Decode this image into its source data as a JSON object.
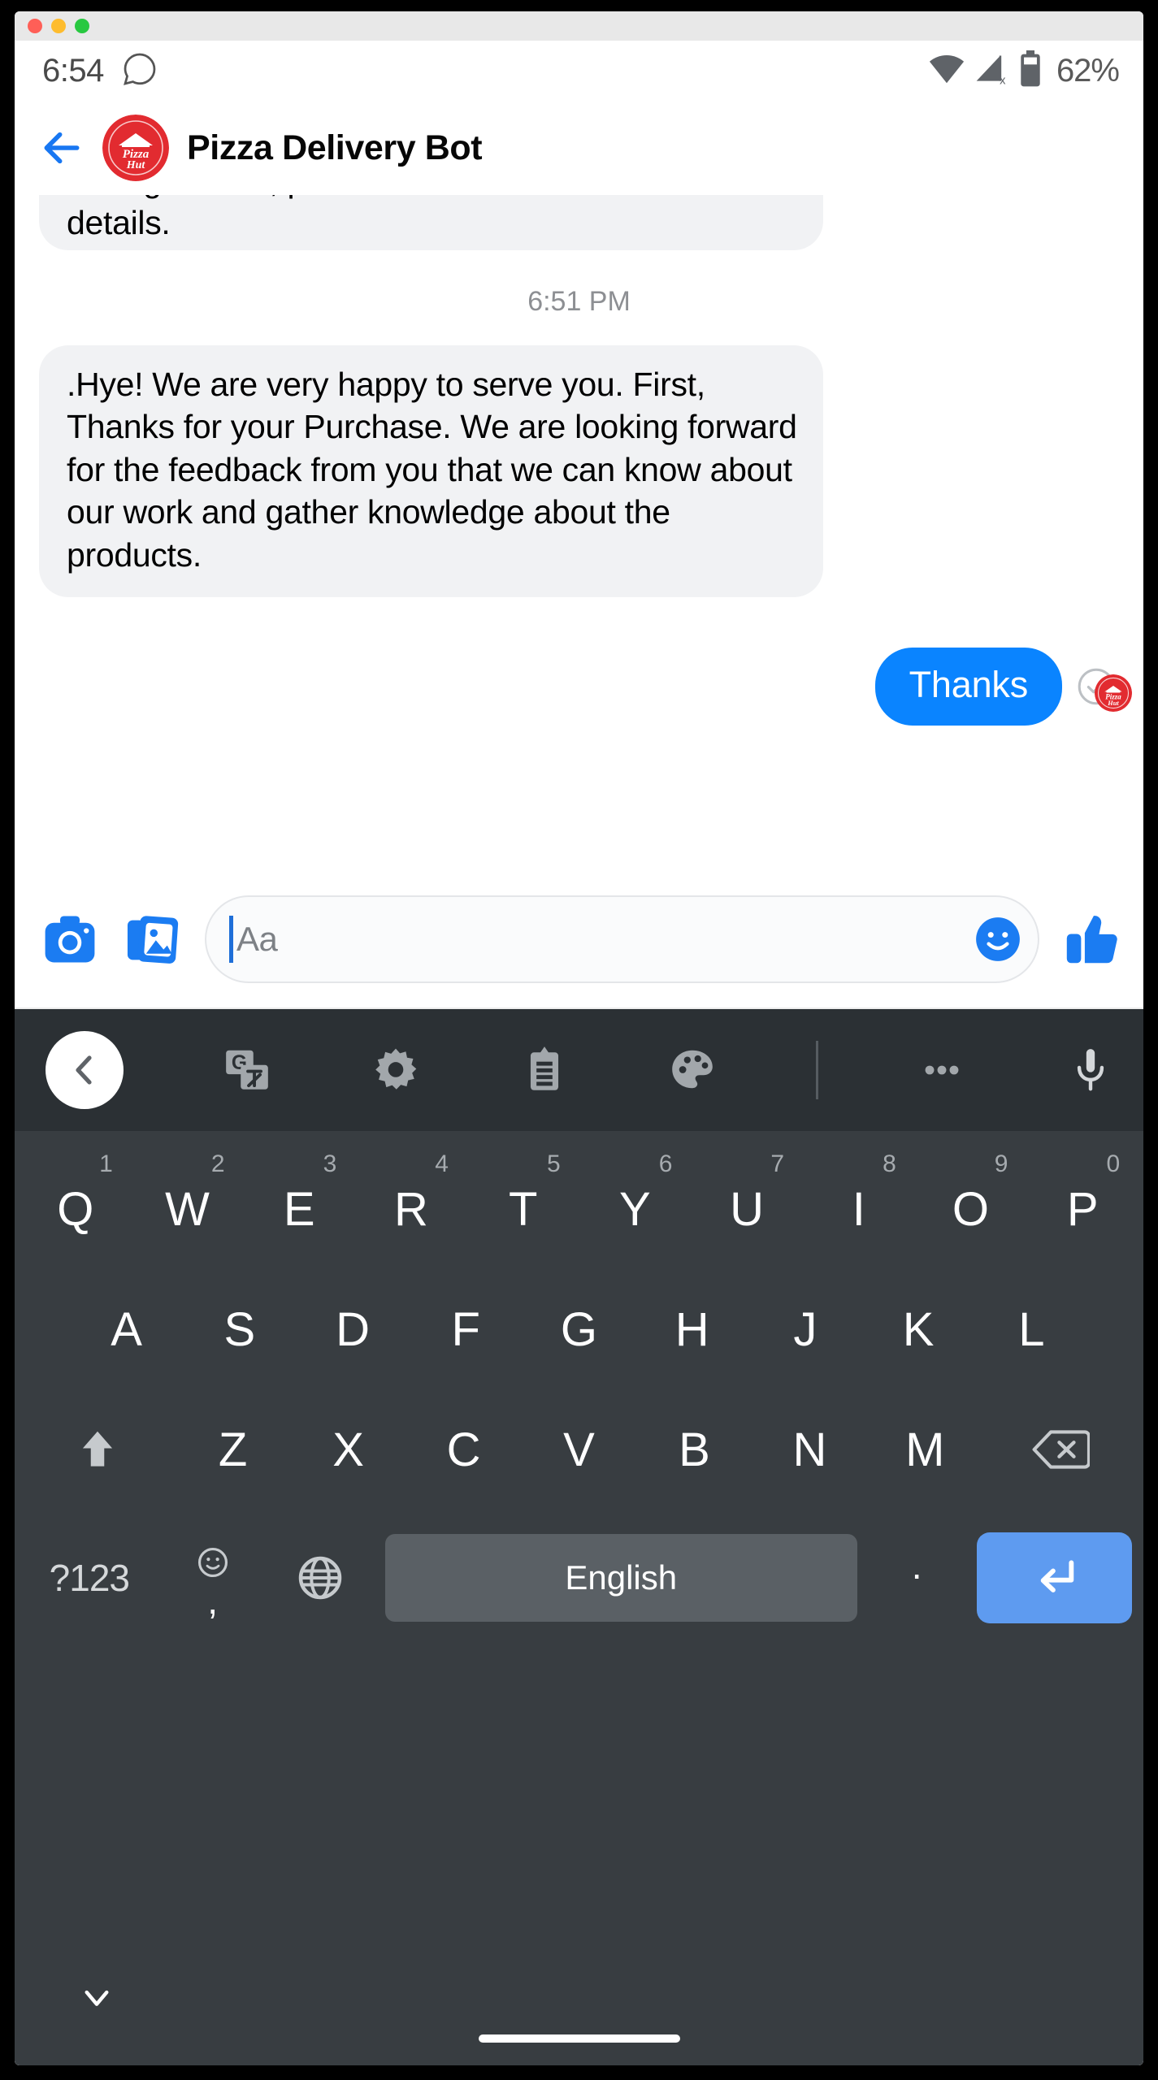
{
  "window": {
    "traffic_lights": [
      "close",
      "minimize",
      "zoom"
    ]
  },
  "status_bar": {
    "time": "6:54",
    "notification_icon": "whatsapp-icon",
    "wifi_icon": "wifi-icon",
    "signal_icon": "signal-off-icon",
    "battery_icon": "battery-icon",
    "battery_percent": "62%"
  },
  "chat_header": {
    "back_icon": "back-arrow-icon",
    "avatar": "pizza-hut-logo",
    "title": "Pizza Delivery Bot"
  },
  "thread": {
    "messages": [
      {
        "id": "m1",
        "direction": "incoming",
        "clipped": true,
        "text": "arrangements, please see our website for more details."
      },
      {
        "id": "timestamp",
        "direction": "meta",
        "text": "6:51 PM"
      },
      {
        "id": "m2",
        "direction": "incoming",
        "text": ".Hye! We are very happy to serve you. First, Thanks for your Purchase. We are looking forward for the feedback from you that we can know about our work and gather knowledge about the products."
      },
      {
        "id": "m3",
        "direction": "outgoing",
        "text": "Thanks",
        "status_icon": "sent-check-icon"
      }
    ]
  },
  "composer": {
    "camera_icon": "camera-icon",
    "gallery_icon": "gallery-icon",
    "placeholder": "Aa",
    "value": "",
    "emoji_icon": "emoji-smiley-icon",
    "like_icon": "thumbs-up-icon"
  },
  "keyboard": {
    "toolbar": [
      {
        "name": "collapse-toolbar-button",
        "icon": "chevron-left-icon"
      },
      {
        "name": "translate-button",
        "icon": "google-translate-icon"
      },
      {
        "name": "settings-button",
        "icon": "gear-icon"
      },
      {
        "name": "clipboard-button",
        "icon": "clipboard-icon"
      },
      {
        "name": "theme-button",
        "icon": "palette-icon"
      },
      {
        "name": "toolbar-divider",
        "icon": "divider"
      },
      {
        "name": "more-options-button",
        "icon": "ellipsis-icon"
      },
      {
        "name": "voice-input-button",
        "icon": "microphone-icon"
      }
    ],
    "row1": [
      {
        "letter": "Q",
        "alt": "1"
      },
      {
        "letter": "W",
        "alt": "2"
      },
      {
        "letter": "E",
        "alt": "3"
      },
      {
        "letter": "R",
        "alt": "4"
      },
      {
        "letter": "T",
        "alt": "5"
      },
      {
        "letter": "Y",
        "alt": "6"
      },
      {
        "letter": "U",
        "alt": "7"
      },
      {
        "letter": "I",
        "alt": "8"
      },
      {
        "letter": "O",
        "alt": "9"
      },
      {
        "letter": "P",
        "alt": "0"
      }
    ],
    "row2": [
      "A",
      "S",
      "D",
      "F",
      "G",
      "H",
      "J",
      "K",
      "L"
    ],
    "row3": {
      "shift_icon": "shift-up-arrow-icon",
      "letters": [
        "Z",
        "X",
        "C",
        "V",
        "B",
        "N",
        "M"
      ],
      "backspace_icon": "backspace-icon"
    },
    "row4": {
      "symbols_label": "?123",
      "emoji_icon": "emoji-outline-icon",
      "comma_label": ",",
      "language_icon": "globe-icon",
      "spacebar_label": "English",
      "period_label": ".",
      "enter_icon": "enter-return-icon"
    }
  },
  "nav_bar": {
    "hide_keyboard_icon": "chevron-down-icon",
    "home_indicator": "home-indicator"
  },
  "colors": {
    "messenger_blue": "#0a84ff",
    "incoming_bubble": "#f1f2f4",
    "pizza_hut_red": "#e22b30",
    "keyboard_bg": "#383d41",
    "keyboard_toolbar_bg": "#2b3034",
    "enter_key_blue": "#5e9bf0"
  }
}
